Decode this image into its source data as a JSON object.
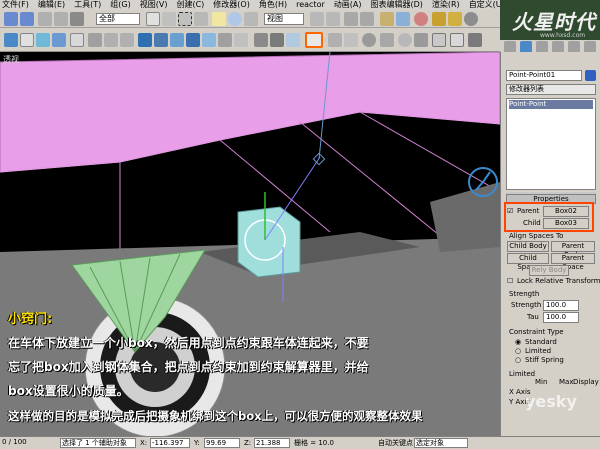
{
  "menu": [
    "文件(F)",
    "编辑(E)",
    "工具(T)",
    "组(G)",
    "视图(V)",
    "创建(C)",
    "修改器(O)",
    "角色(H)",
    "reactor",
    "动画(A)",
    "图表编辑器(D)",
    "渲染(R)",
    "自定义(U)",
    "MAXScript(M)",
    "帮助(H)"
  ],
  "toolbar": {
    "selection_filter": "全部",
    "coord_system": "视图"
  },
  "logo": {
    "text": "火星时代",
    "url": "www.hxsd.com"
  },
  "viewport": {
    "label": "透视",
    "tip_title": "小窍门:",
    "tip_lines": [
      "在车体下放建立一个小box，然后用点到点约束跟车体连起来，不要",
      "忘了把box加入到钢体集合，把点到点约束加到约束解算器里，并给",
      "box设置很小的质量。",
      "这样做的目的是模拟完成后把摄象机绑到这个box上，可以很方便的观察整体效果"
    ]
  },
  "panel": {
    "object_name": "Point-Point01",
    "modifier_list": "修改器列表",
    "stack_item": "Point-Point",
    "properties_header": "Properties",
    "parent_label": "Parent",
    "parent_value": "Box02",
    "child_label": "Child",
    "child_value": "Box03",
    "align_header": "Align Spaces To",
    "btn_child_body": "Child Body",
    "btn_parent_body": "Parent Body",
    "btn_child_space": "Child Space",
    "btn_parent_space": "Parent Space",
    "btn_rely_body": "Rely Body",
    "lock_label": "Lock Relative Transform",
    "strength_header": "Strength",
    "strength_label": "Strength",
    "strength_value": "100.0",
    "tau_label": "Tau",
    "tau_value": "100.0",
    "constraint_header": "Constraint Type",
    "type_standard": "Standard",
    "type_limited": "Limited",
    "type_stiff": "Stiff Spring",
    "limited_header": "Limited",
    "min_label": "Min",
    "max_label": "Max",
    "display_label": "Display",
    "x_axis": "X Axis",
    "y_axis": "Y Axis"
  },
  "status": {
    "frame": "0 / 100",
    "selection": "选择了 1 个辅助对象",
    "x": "-116.397",
    "y": "99.69",
    "z": "21.388",
    "grid": "栅格 = 10.0",
    "auto_key": "自动关键点",
    "selected_object": "选定对象",
    "set_key": "设置关键点",
    "key_filter": "关键点过滤器...",
    "hint": "单击并拖动以选择并移动对象",
    "add_time_tag": "添加时间标记"
  },
  "watermark": "yesky",
  "colors": {
    "accent": "#ff6600",
    "viewport_bg": "#000000",
    "pink": "#e89ee8",
    "cyan": "#a0dedc",
    "green": "#9fd69f"
  }
}
